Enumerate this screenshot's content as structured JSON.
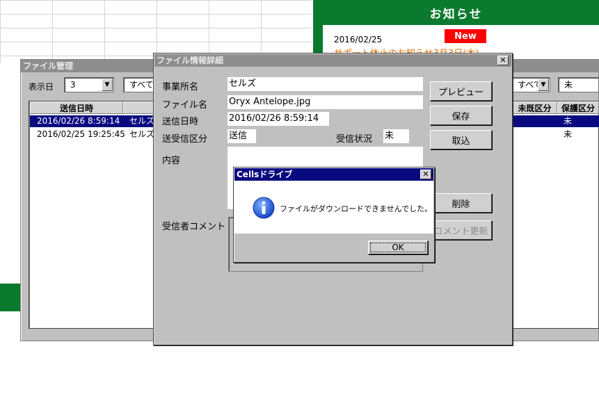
{
  "news": {
    "title": "お知らせ",
    "date": "2016/02/25",
    "badge": "New",
    "link": "サポート休止のお知らせ3月3日(木)"
  },
  "file_manager": {
    "title": "ファイル管理",
    "display_label": "表示日",
    "display_value": "3",
    "filter_value": "すべて",
    "filter2_value": "すべて",
    "filter3_value": "未",
    "columns": [
      "送信日時",
      "未既区分",
      "保護区分"
    ],
    "rows": [
      {
        "sent": "2016/02/26 8:59:14",
        "office": "セルズ",
        "read_status": "未",
        "selected": true
      },
      {
        "sent": "2016/02/25 19:25:45",
        "office": "セルズ",
        "read_status": "未",
        "selected": false
      }
    ]
  },
  "detail": {
    "title": "ファイル情報詳細",
    "office_label": "事業所名",
    "office_value": "セルズ",
    "file_label": "ファイル名",
    "file_value": "Oryx Antelope.jpg",
    "sent_label": "送信日時",
    "sent_value": "2016/02/26 8:59:14",
    "type_label": "送受信区分",
    "type_value": "送信",
    "recv_status_label": "受信状況",
    "recv_status_value": "未",
    "content_label": "内容",
    "comment_label": "受信者コメント",
    "buttons": {
      "preview": "プレビュー",
      "save": "保存",
      "import": "取込",
      "delete": "削除",
      "update_comment": "コメント更新"
    }
  },
  "message_box": {
    "title": "Cellsドライブ",
    "text": "ファイルがダウンロードできませんでした。",
    "ok": "OK"
  },
  "colors": {
    "green": "#0a7a2f",
    "selection": "#0a0a80",
    "badge": "#ff0000",
    "link": "#e07000"
  }
}
